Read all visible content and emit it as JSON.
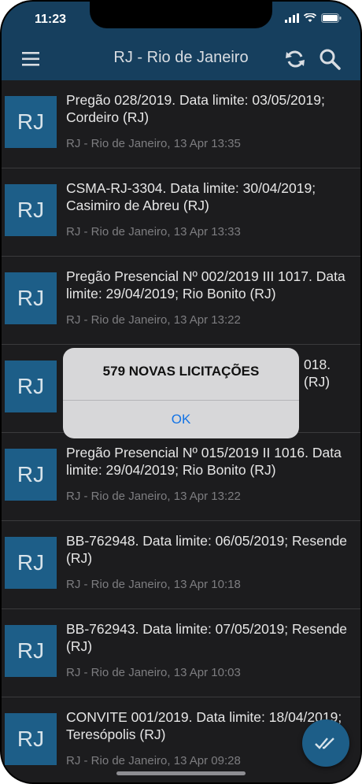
{
  "status": {
    "time": "11:23"
  },
  "header": {
    "title": "RJ - Rio de Janeiro"
  },
  "items": [
    {
      "avatar": "RJ",
      "title": "Pregão 028/2019. Data limite: 03/05/2019; Cordeiro (RJ)",
      "subtitle": "RJ - Rio de Janeiro, 13 Apr 13:35"
    },
    {
      "avatar": "RJ",
      "title": "CSMA-RJ-3304. Data limite: 30/04/2019; Casimiro de Abreu (RJ)",
      "subtitle": "RJ - Rio de Janeiro, 13 Apr 13:33"
    },
    {
      "avatar": "RJ",
      "title": "Pregão Presencial Nº 002/2019 III 1017. Data limite: 29/04/2019; Rio Bonito (RJ)",
      "subtitle": "RJ - Rio de Janeiro, 13 Apr 13:22"
    },
    {
      "avatar": "RJ",
      "title": "",
      "subtitle": ""
    },
    {
      "avatar": "RJ",
      "title": "Pregão Presencial Nº 015/2019 II 1016. Data limite: 29/04/2019; Rio Bonito (RJ)",
      "subtitle": "RJ - Rio de Janeiro, 13 Apr 13:22"
    },
    {
      "avatar": "RJ",
      "title": "BB-762948. Data limite: 06/05/2019; Resende (RJ)",
      "subtitle": "RJ - Rio de Janeiro, 13 Apr 10:18"
    },
    {
      "avatar": "RJ",
      "title": "BB-762943. Data limite: 07/05/2019; Resende (RJ)",
      "subtitle": "RJ - Rio de Janeiro, 13 Apr 10:03"
    },
    {
      "avatar": "RJ",
      "title": "CONVITE 001/2019. Data limite: 18/04/2019; Teresópolis (RJ)",
      "subtitle": "RJ - Rio de Janeiro, 13 Apr 09:28"
    }
  ],
  "partial_hidden_text": {
    "line1_tail": "018.",
    "line2_tail": "(RJ)"
  },
  "alert": {
    "message": "579 NOVAS LICITAÇÕES",
    "ok_label": "OK"
  },
  "icons": {
    "menu": "hamburger-menu-icon",
    "refresh": "refresh-icon",
    "search": "search-icon",
    "fab": "double-check-icon"
  },
  "colors": {
    "navbar": "#163f5e",
    "avatar": "#1d5e88",
    "alert_button": "#1273e6"
  }
}
